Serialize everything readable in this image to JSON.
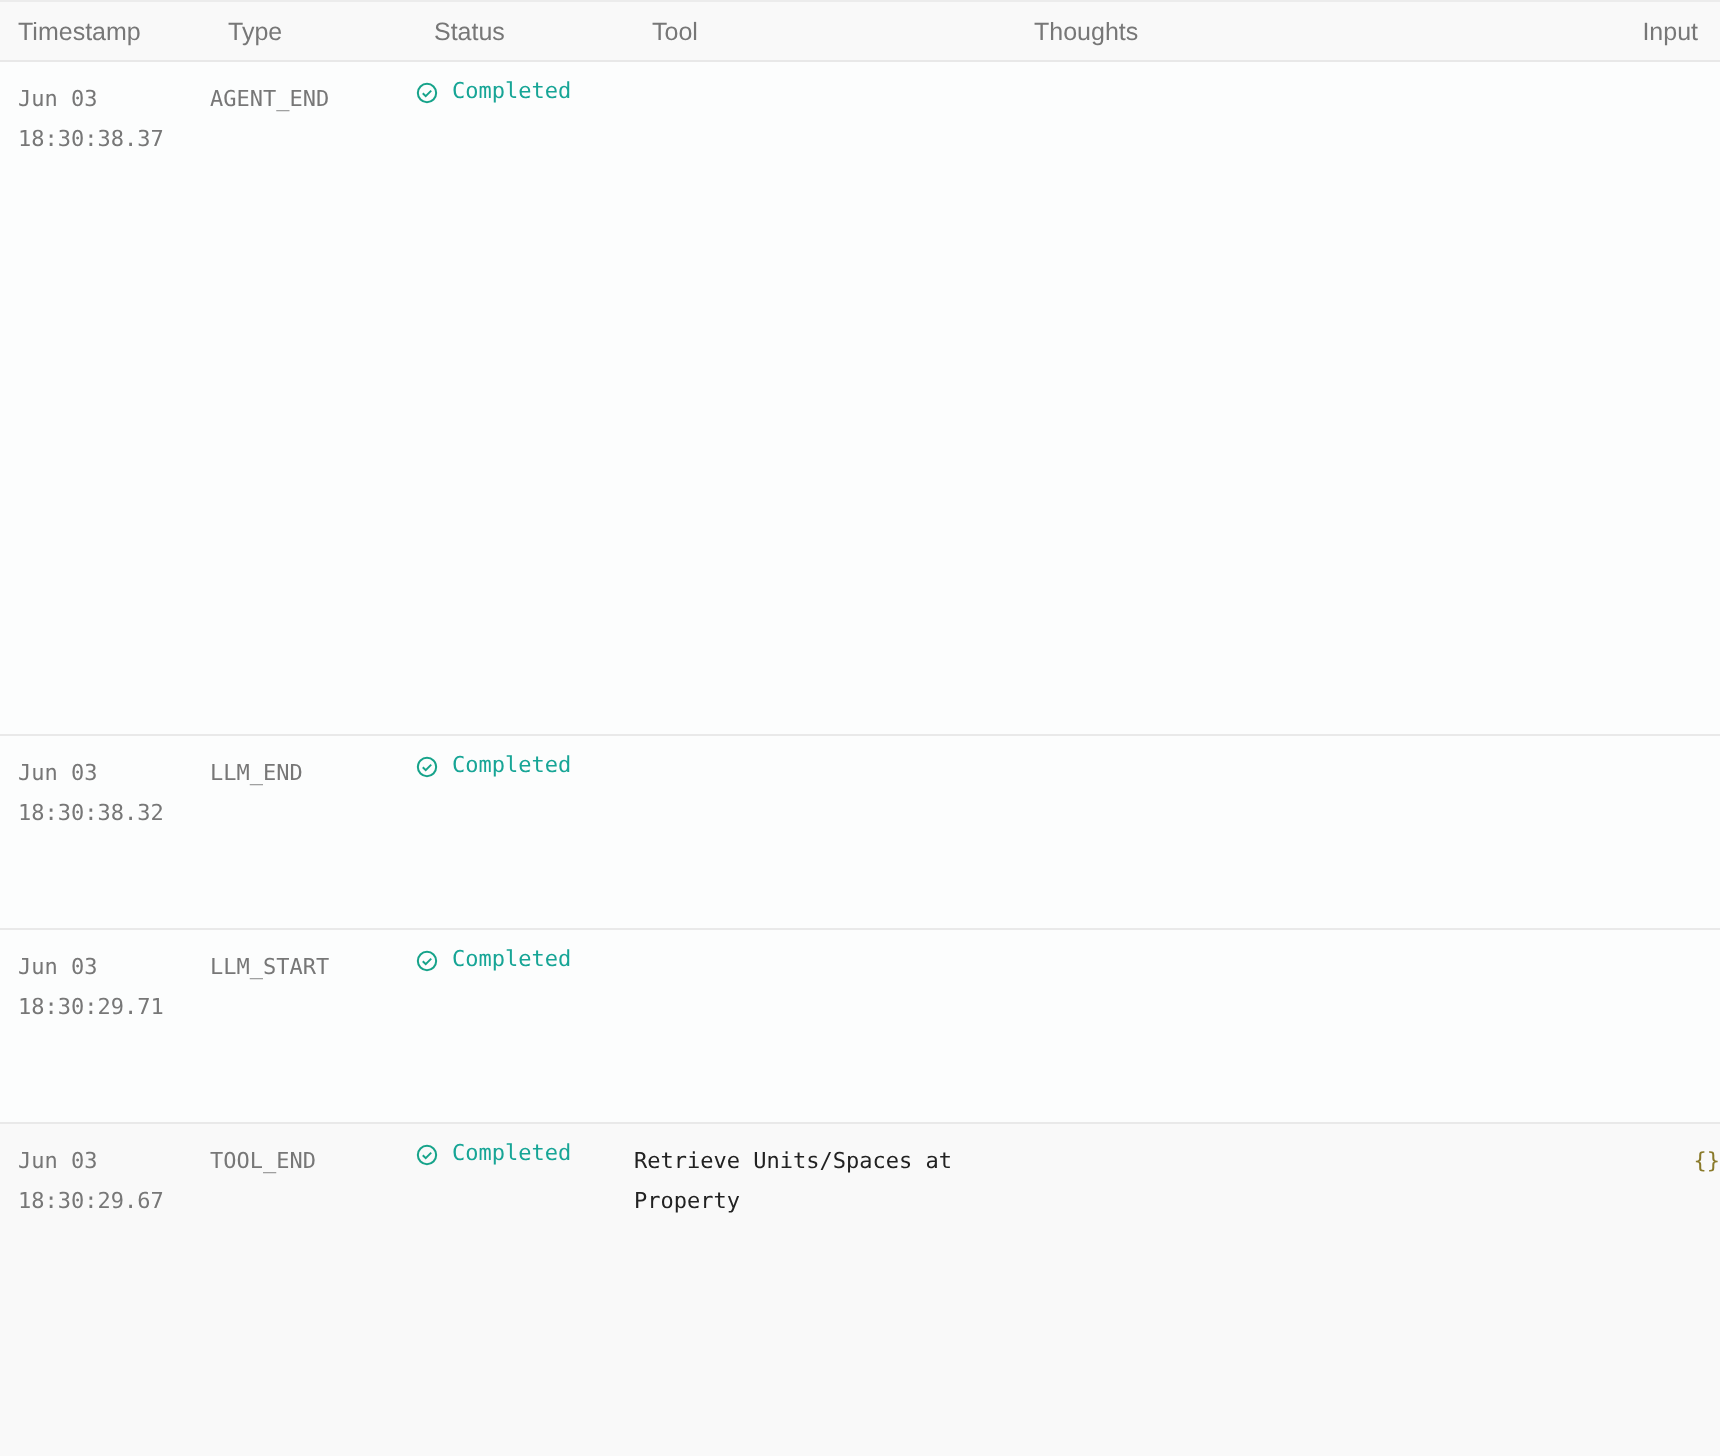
{
  "table": {
    "columns": [
      "Timestamp",
      "Type",
      "Status",
      "Tool",
      "Thoughts",
      "Input"
    ],
    "rows": [
      {
        "date": "Jun 03",
        "time": "18:30:38.37",
        "type": "AGENT_END",
        "status": "Completed",
        "tool": "",
        "input": "",
        "selected": false
      },
      {
        "date": "Jun 03",
        "time": "18:30:38.32",
        "type": "LLM_END",
        "status": "Completed",
        "tool": "",
        "input": "",
        "selected": false
      },
      {
        "date": "Jun 03",
        "time": "18:30:29.71",
        "type": "LLM_START",
        "status": "Completed",
        "tool": "",
        "input": "",
        "selected": false
      },
      {
        "date": "Jun 03",
        "time": "18:30:29.67",
        "type": "TOOL_END",
        "status": "Completed",
        "tool": "Retrieve Units/Spaces at Property",
        "input": "{}",
        "selected": true
      }
    ]
  }
}
